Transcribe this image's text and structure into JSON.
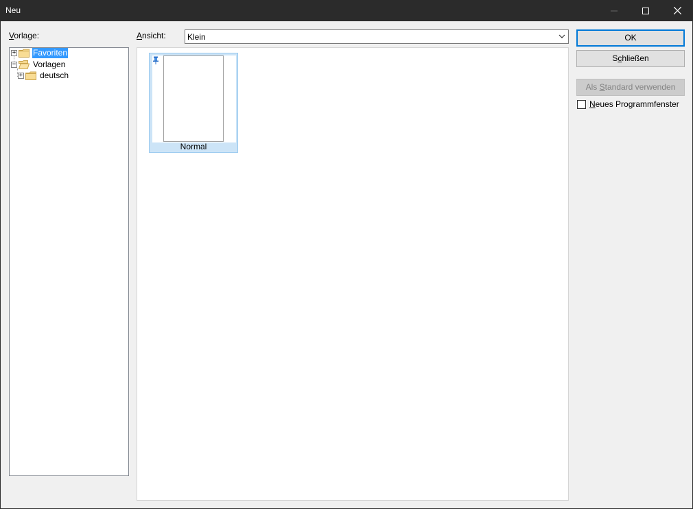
{
  "window": {
    "title": "Neu"
  },
  "template_panel": {
    "label_prefix": "V",
    "label_rest": "orlage:",
    "tree": [
      {
        "label": "Favoriten",
        "expander": "+",
        "icon": "folder-closed-icon",
        "selected": true
      },
      {
        "label": "Vorlagen",
        "expander": "−",
        "icon": "folder-open-icon",
        "selected": false
      },
      {
        "label": "deutsch",
        "expander": "+",
        "icon": "folder-closed-icon",
        "selected": false
      }
    ]
  },
  "view": {
    "label_prefix": "A",
    "label_rest": "nsicht:",
    "selected": "Klein"
  },
  "templates": [
    {
      "name": "Normal",
      "pinned": true
    }
  ],
  "buttons": {
    "ok": "OK",
    "close_prefix": "S",
    "close_ul": "c",
    "close_rest": "hließen",
    "default_prefix": "Als ",
    "default_ul": "S",
    "default_rest": "tandard verwenden"
  },
  "new_window": {
    "label_ul": "N",
    "label_rest": "eues Programmfenster",
    "checked": false
  },
  "colors": {
    "titlebar": "#2b2b2b",
    "selection": "#3399ff",
    "accent": "#0078d7",
    "tile_bg": "#cce4f7"
  }
}
